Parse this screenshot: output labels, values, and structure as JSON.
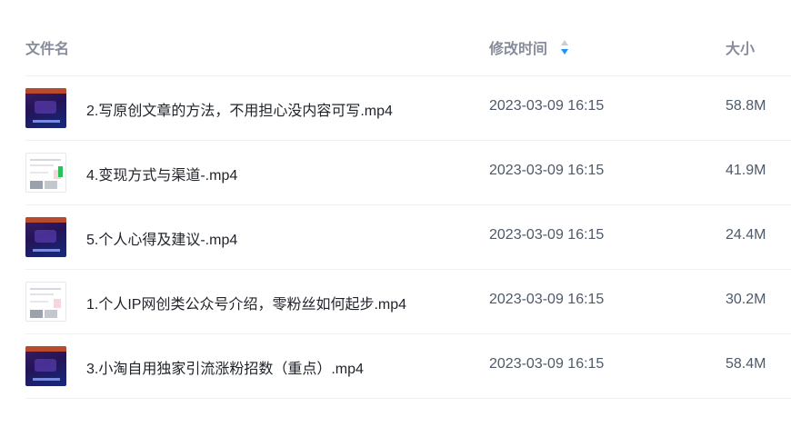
{
  "columns": {
    "name": "文件名",
    "mtime": "修改时间",
    "size": "大小"
  },
  "sort": {
    "column": "mtime",
    "direction": "descending",
    "icon": "sort-icon",
    "active_color": "#1e90ff"
  },
  "files": [
    {
      "name": "2.写原创文章的方法，不用担心没内容可写.mp4",
      "mtime": "2023-03-09 16:15",
      "size": "58.8M",
      "thumbnail": "dark"
    },
    {
      "name": "4.变现方式与渠道-.mp4",
      "mtime": "2023-03-09 16:15",
      "size": "41.9M",
      "thumbnail": "light"
    },
    {
      "name": "5.个人心得及建议-.mp4",
      "mtime": "2023-03-09 16:15",
      "size": "24.4M",
      "thumbnail": "dark"
    },
    {
      "name": "1.个人IP网创类公众号介绍，零粉丝如何起步.mp4",
      "mtime": "2023-03-09 16:15",
      "size": "30.2M",
      "thumbnail": "light"
    },
    {
      "name": "3.小淘自用独家引流涨粉招数（重点）.mp4",
      "mtime": "2023-03-09 16:15",
      "size": "58.4M",
      "thumbnail": "dark"
    }
  ]
}
